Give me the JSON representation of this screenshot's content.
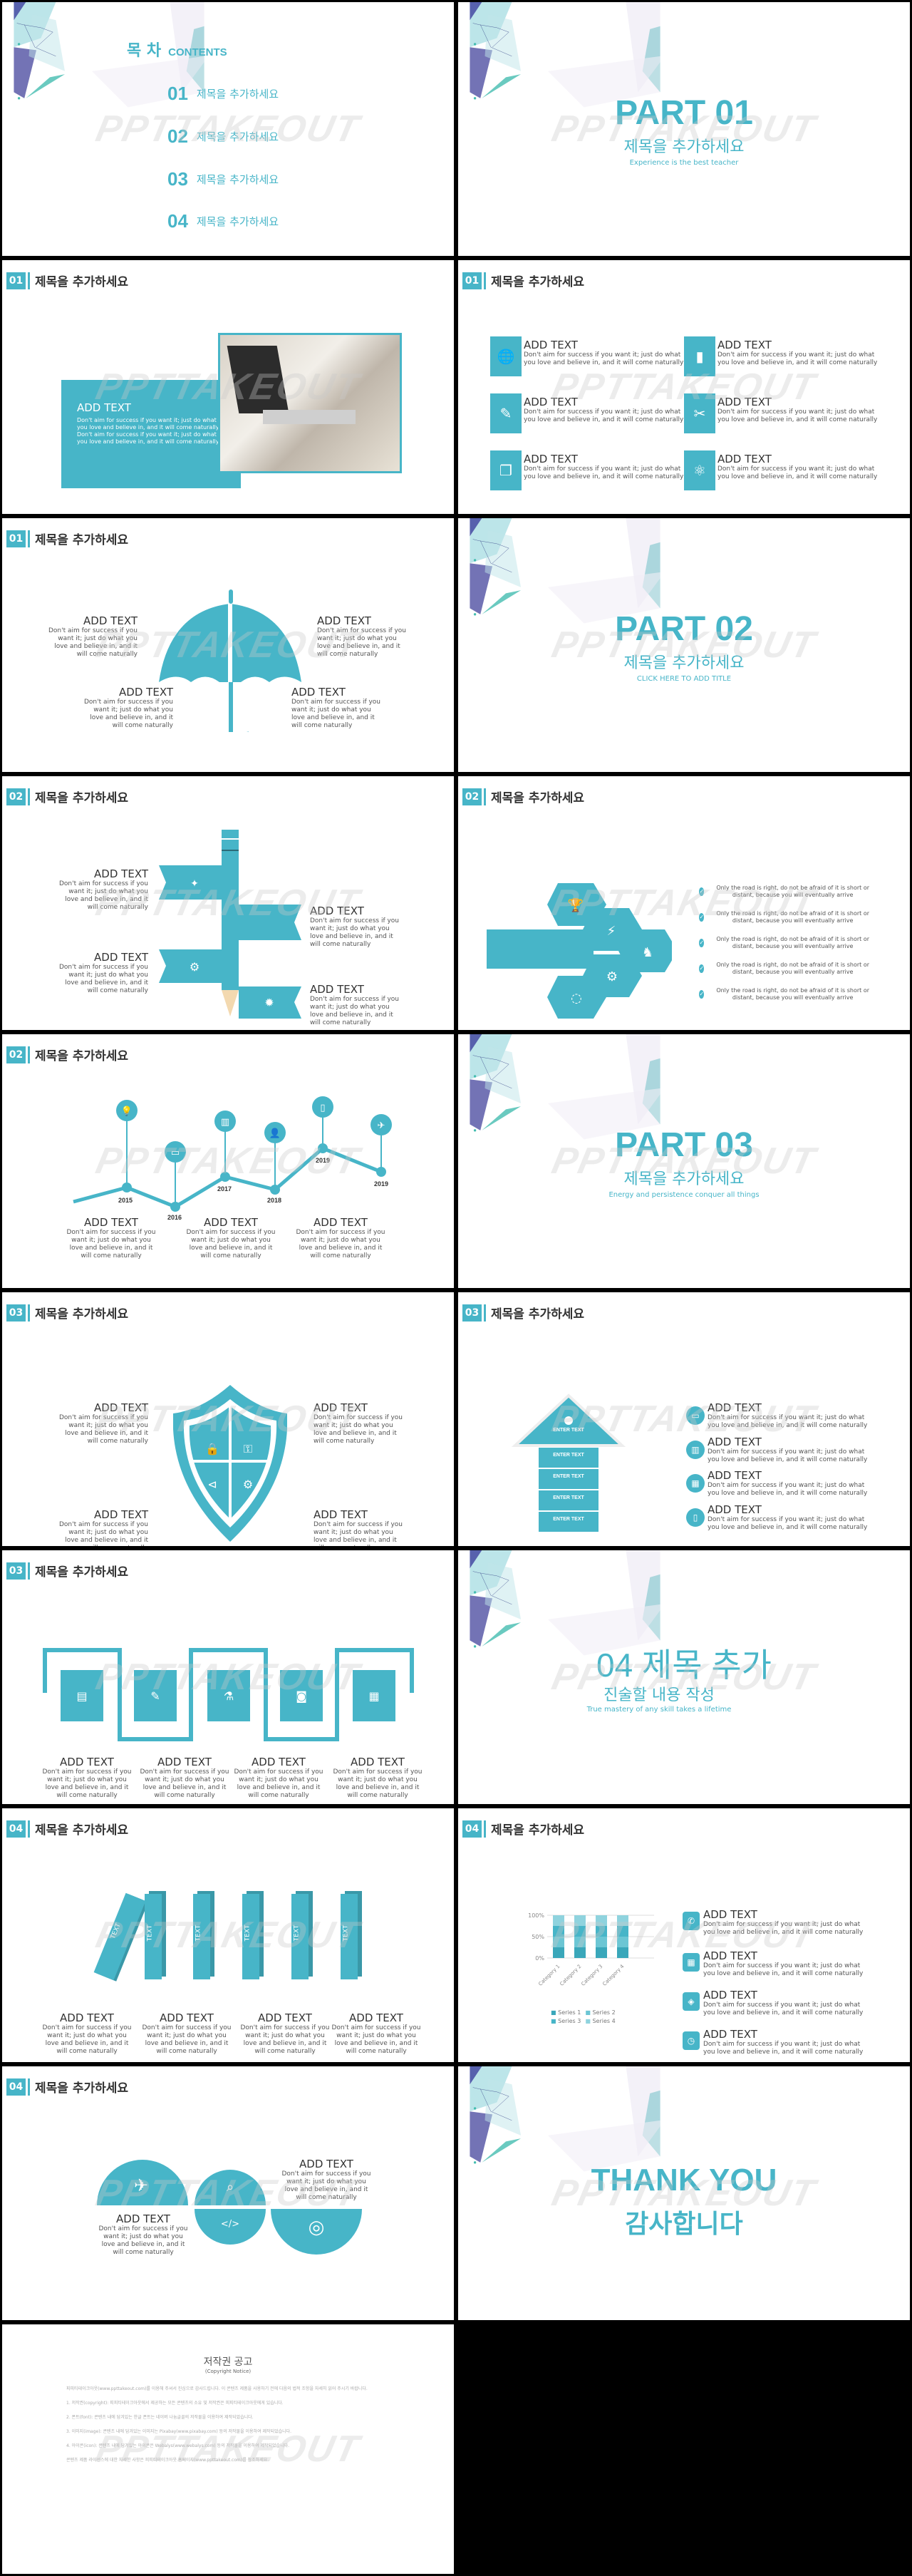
{
  "watermark": "PPTTAKEOUT",
  "section_title": "제목을 추가하세요",
  "add_text": "ADD TEXT",
  "body_short": "Don't aim for success if you want it; just do what you love and believe in, and it will come naturally",
  "contents": {
    "title_ko": "목 차",
    "title_en": "CONTENTS",
    "items": [
      {
        "num": "01",
        "label": "제목을 추가하세요"
      },
      {
        "num": "02",
        "label": "제목을 추가하세요"
      },
      {
        "num": "03",
        "label": "제목을 추가하세요"
      },
      {
        "num": "04",
        "label": "제목을 추가하세요"
      }
    ]
  },
  "parts": [
    {
      "title": "PART 01",
      "subtitle": "제목을 추가하세요",
      "caption": "Experience is the best teacher"
    },
    {
      "title": "PART 02",
      "subtitle": "제목을 추가하세요",
      "caption": "CLICK HERE TO ADD TITLE"
    },
    {
      "title": "PART 03",
      "subtitle": "제목을 추가하세요",
      "caption": "Energy and persistence conquer all things"
    },
    {
      "title": "04 제목 추가",
      "subtitle": "진술할 내용 작성",
      "caption": "True mastery of any skill takes a lifetime"
    }
  ],
  "slides": {
    "s3": {
      "num": "01",
      "heading": "ADD TEXT",
      "body": "Don't aim for success if you want it; just do what you love and believe in, and it will come naturally Don't aim for success if you want it; just do what you love and believe in, and it will come naturally"
    },
    "s4": {
      "num": "01",
      "items": [
        {
          "icon": "globe-icon",
          "glyph": "🌐"
        },
        {
          "icon": "book-icon",
          "glyph": "▮"
        },
        {
          "icon": "brush-icon",
          "glyph": "✎"
        },
        {
          "icon": "tools-icon",
          "glyph": "✂"
        },
        {
          "icon": "documents-icon",
          "glyph": "❐"
        },
        {
          "icon": "atom-icon",
          "glyph": "⚛"
        }
      ]
    },
    "s5": {
      "num": "01"
    },
    "s7": {
      "num": "02"
    },
    "s8": {
      "num": "02",
      "bullet": "Only the road is right, do not be afraid of it is short or distant, because you will eventually arrive",
      "count": 5
    },
    "s9": {
      "num": "02",
      "years": [
        "2015",
        "2016",
        "2017",
        "2018",
        "2019",
        "2019"
      ]
    },
    "s11": {
      "num": "03"
    },
    "s12": {
      "num": "03",
      "enter_text": "ENTER TEXT"
    },
    "s13": {
      "num": "03"
    },
    "s15": {
      "num": "04",
      "domino_label": "TEXT"
    },
    "s16": {
      "num": "04"
    },
    "s17": {
      "num": "04"
    }
  },
  "thankyou": {
    "en": "THANK YOU",
    "ko": "감사합니다"
  },
  "copyright": {
    "title": "저작권 공고",
    "subtitle": "(Copyright Notice)",
    "paragraphs": [
      "피피티테이크아웃(www.ppttakeout.com)를 이용해 주셔서 진심으로 감사드립니다. 이 콘텐츠 제품을 사용하기 전에 다음의 법적 조항을 자세히 읽어 주시기 바랍니다.",
      "1. 저작권(copyright): 피피티테이크아웃에서 제공하는 모든 콘텐츠의 소유 및 저작권은 피피티테이크아웃에게 있습니다.",
      "2. 폰트(font): 콘텐츠 내에 담겨있는 한글 폰트는 네이버 나눔글꼴의 저작물을 이용하여 제작되었습니다.",
      "3. 이미지(image): 콘텐츠 내에 담겨있는 이미지는 Pixabay(www.pixabay.com) 등의 저작물을 이용하여 제작되었습니다.",
      "4. 아이콘(icon): 콘텐츠 내에 담겨있는 아이콘은 Webalys(www.webalys.com) 등의 저작물을 이용하여 제작되었습니다.",
      "콘텐츠 제품 라이선스에 대한 자세한 사항은 피피티테이크아웃 홈페이지(www.ppttakeout.com)를 참조하세요."
    ]
  },
  "chart_data": {
    "type": "bar",
    "title": "",
    "categories": [
      "Category 1",
      "Category 2",
      "Category 3",
      "Category 4"
    ],
    "series": [
      {
        "name": "Series 1",
        "values": [
          25,
          25,
          25,
          25
        ]
      },
      {
        "name": "Series 2",
        "values": [
          25,
          25,
          25,
          25
        ]
      },
      {
        "name": "Series 3",
        "values": [
          25,
          25,
          25,
          25
        ]
      },
      {
        "name": "Series 4",
        "values": [
          25,
          25,
          25,
          25
        ]
      }
    ],
    "stacked_percent": true,
    "yticks": [
      "0%",
      "50%",
      "100%"
    ],
    "ylim": [
      0,
      100
    ],
    "legend": "bottom"
  },
  "colors": {
    "accent": "#47b5c8",
    "dark": "#333333"
  }
}
